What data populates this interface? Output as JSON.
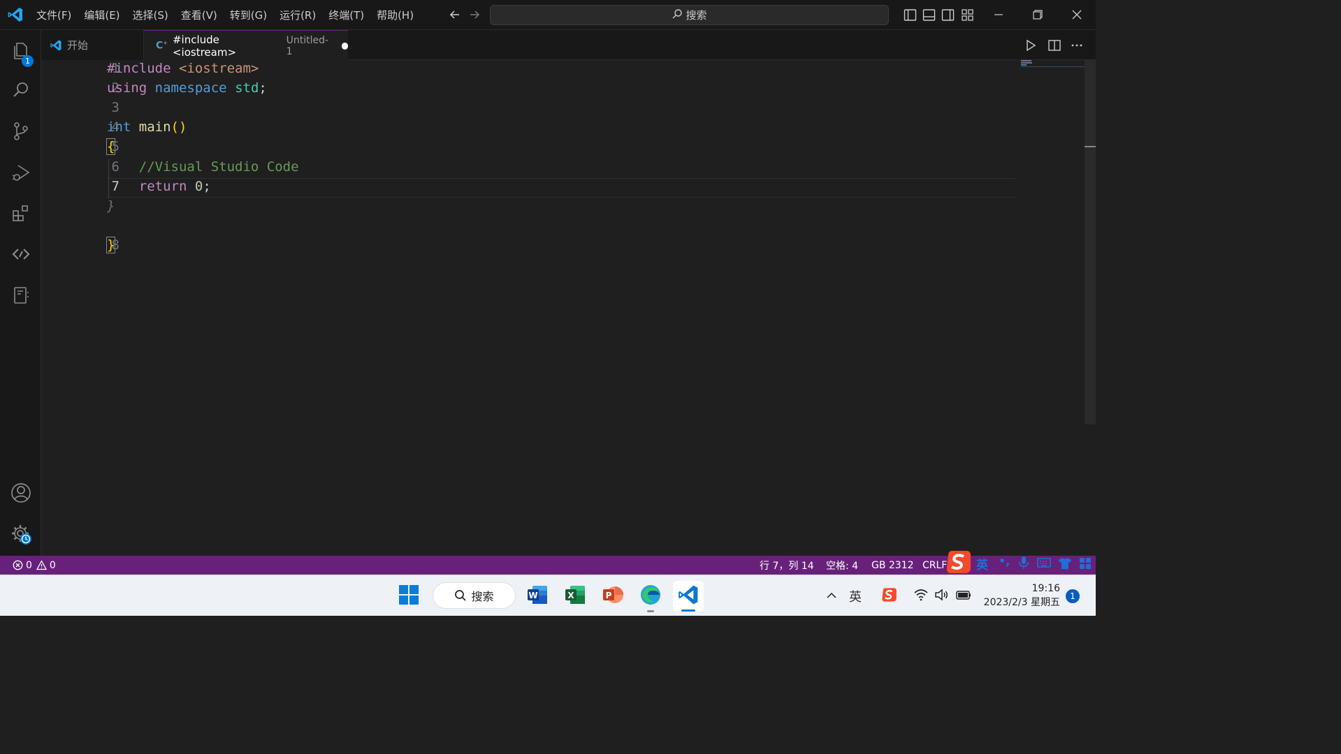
{
  "titlebar": {
    "menu": [
      "文件(F)",
      "编辑(E)",
      "选择(S)",
      "查看(V)",
      "转到(G)",
      "运行(R)",
      "终端(T)",
      "帮助(H)"
    ],
    "search_label": "搜索"
  },
  "activity": {
    "explorer_badge": "1"
  },
  "tabs": [
    {
      "label": "开始"
    },
    {
      "label": "#include <iostream>",
      "description": "Untitled-1",
      "dirty": true
    }
  ],
  "editor": {
    "lines": [
      {
        "num": "1",
        "text": "#include <iostream>"
      },
      {
        "num": "2",
        "text": "using namespace std;"
      },
      {
        "num": "3",
        "text": ""
      },
      {
        "num": "4",
        "text": "int main()"
      },
      {
        "num": "5",
        "text": "{"
      },
      {
        "num": "6",
        "text": "    //Visual Studio Code"
      },
      {
        "num": "7",
        "text": "    return 0;"
      },
      {
        "num": "",
        "text": "}"
      },
      {
        "num": "8",
        "text": "}"
      }
    ],
    "current_line": "7"
  },
  "statusbar": {
    "errors": "0",
    "warnings": "0",
    "position": "行 7，列 14",
    "spaces": "空格: 4",
    "encoding": "GB 2312",
    "eol": "CRLF"
  },
  "ime": {
    "lang": "英",
    "punct": "•,"
  },
  "taskbar": {
    "search_label": "搜索",
    "tray_lang": "英",
    "time": "19:16",
    "date": "2023/2/3 星期五",
    "notification_count": "1"
  },
  "colors": {
    "accent": "#68217a",
    "vscode_blue": "#23a6f0",
    "keyword_purple": "#c586c0",
    "keyword_blue": "#569cd6",
    "type_teal": "#4ec9b0",
    "string_orange": "#ce9178",
    "comment_green": "#6a9955",
    "bracket_yellow": "#ffd700"
  }
}
